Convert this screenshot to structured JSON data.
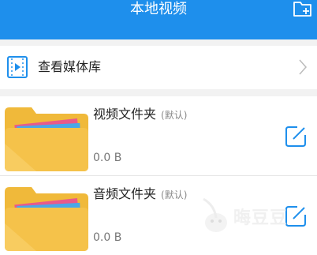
{
  "header": {
    "title": "本地视频",
    "add_icon": "add-folder-icon"
  },
  "library": {
    "label": "查看媒体库",
    "icon": "video-library-icon"
  },
  "folders": [
    {
      "name": "视频文件夹",
      "tag": "(默认)",
      "size": "0.0 B"
    },
    {
      "name": "音频文件夹",
      "tag": "(默认)",
      "size": "0.0 B"
    }
  ],
  "watermark": {
    "text": "晦豆豆"
  },
  "colors": {
    "accent": "#1e8fec",
    "folder_body": "#f5c24a",
    "folder_tab": "#f0b93a",
    "page_bg": "#f2f2f2"
  }
}
